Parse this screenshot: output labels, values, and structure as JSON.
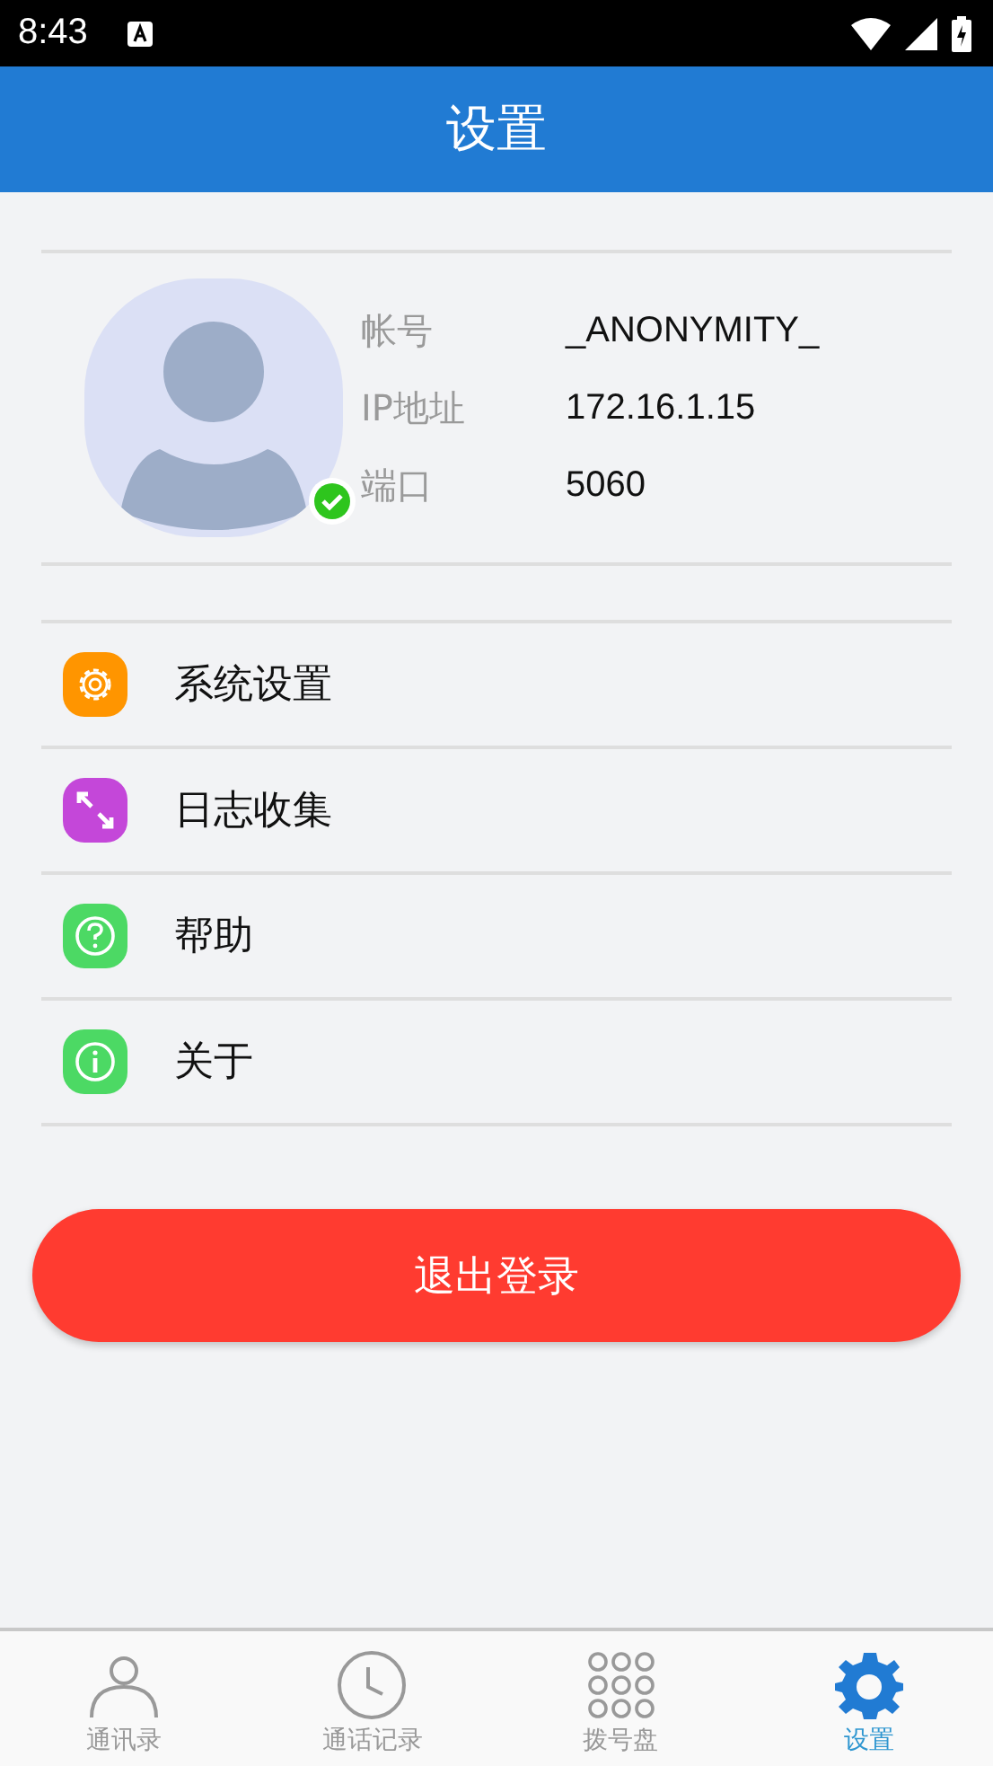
{
  "status_bar": {
    "time": "8:43"
  },
  "header": {
    "title": "设置"
  },
  "profile": {
    "online": true,
    "fields": [
      {
        "label": "帐号",
        "value": "_ANONYMITY_"
      },
      {
        "label": "IP地址",
        "value": "172.16.1.15"
      },
      {
        "label": "端口",
        "value": "5060"
      }
    ]
  },
  "menu": [
    {
      "kind": "gear",
      "label": "系统设置",
      "color": "#ff9500"
    },
    {
      "kind": "arrows",
      "label": "日志收集",
      "color": "#c447d9"
    },
    {
      "kind": "help",
      "label": "帮助",
      "color": "#4cd964"
    },
    {
      "kind": "info",
      "label": "关于",
      "color": "#4cd964"
    }
  ],
  "logout_button": "退出登录",
  "tabs": [
    {
      "kind": "contacts",
      "label": "通讯录",
      "selected": false
    },
    {
      "kind": "history",
      "label": "通话记录",
      "selected": false
    },
    {
      "kind": "dialpad",
      "label": "拨号盘",
      "selected": false
    },
    {
      "kind": "settings",
      "label": "设置",
      "selected": true
    }
  ]
}
